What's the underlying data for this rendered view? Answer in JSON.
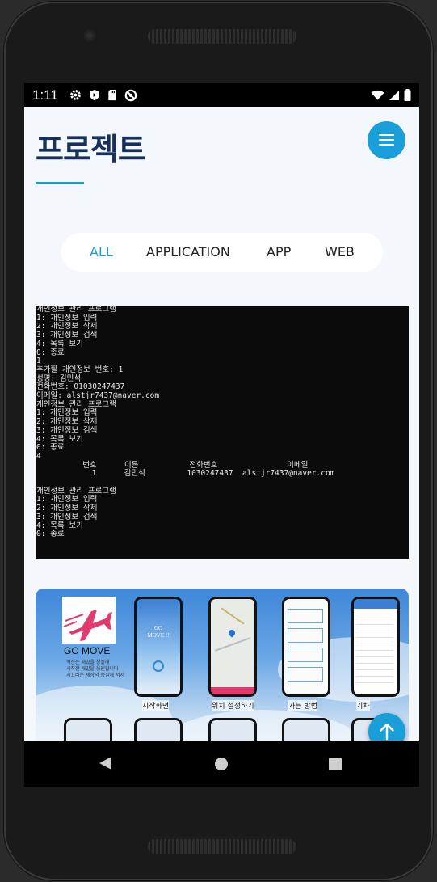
{
  "status_bar": {
    "time": "1:11",
    "left_icons": [
      "gear-icon",
      "play-protect-icon",
      "sd-card-icon",
      "no-disturb-icon"
    ],
    "right_icons": [
      "wifi-icon",
      "cell-signal-icon",
      "battery-icon"
    ]
  },
  "page": {
    "title": "프로젝트",
    "accent_color": "#1a9ed8",
    "title_color": "#17315c"
  },
  "filter_tabs": [
    {
      "label": "ALL",
      "active": true
    },
    {
      "label": "APPLICATION",
      "active": false
    },
    {
      "label": "APP",
      "active": false
    },
    {
      "label": "WEB",
      "active": false
    }
  ],
  "project_1": {
    "terminal_lines": [
      "개인정보 관리 프로그램",
      "1: 개인정보 입력",
      "2: 개인정보 삭제",
      "3: 개인정보 검색",
      "4: 목록 보기",
      "0: 종료",
      "1",
      "추가할 개인정보 번호: 1",
      "성명: 김민석",
      "전화번호: 01030247437",
      "이메일: alstjr7437@naver.com",
      "개인정보 관리 프로그램",
      "1: 개인정보 입력",
      "2: 개인정보 삭제",
      "3: 개인정보 검색",
      "4: 목록 보기",
      "0: 종료",
      "4",
      "          번호      이름           전화번호               이메일",
      "            1      김민석         1030247437  alstjr7437@naver.com",
      "",
      "개인정보 관리 프로그램",
      "1: 개인정보 입력",
      "2: 개인정보 삭제",
      "3: 개인정보 검색",
      "4: 목록 보기",
      "0: 종료"
    ]
  },
  "project_2": {
    "logo_text": "GO MOVE",
    "tagline_lines": [
      "혁신는 재밌을 창출해",
      "시작한 개발을 응원합니다",
      "시끄러운 세상의 중심에 서서"
    ],
    "phone_screen_text": "GO MOVE !!",
    "captions": [
      "시작화면",
      "위치 설정하기",
      "가는 방법",
      "기차"
    ]
  },
  "buttons": {
    "menu_icon": "hamburger-menu-icon",
    "scroll_top_icon": "arrow-up-icon"
  },
  "nav": {
    "back_icon": "back-triangle-icon",
    "home_icon": "home-circle-icon",
    "recent_icon": "recent-apps-square-icon"
  }
}
